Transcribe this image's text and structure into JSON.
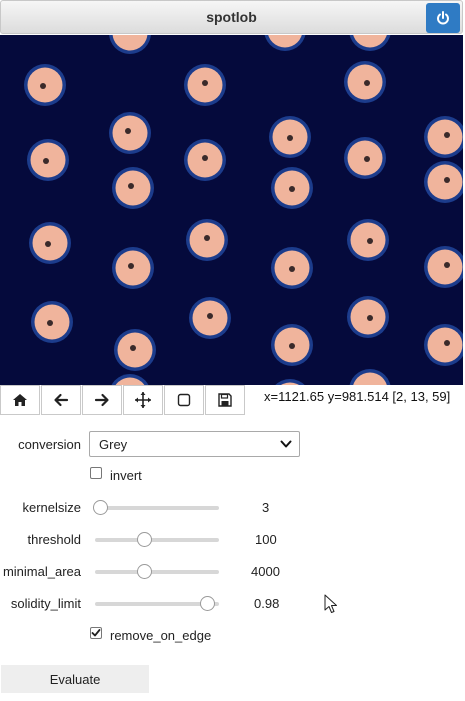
{
  "window": {
    "title": "spotlob"
  },
  "icons": {
    "close": "power-icon",
    "home": "home-icon",
    "back": "arrow-left-icon",
    "forward": "arrow-right-icon",
    "pan": "move-icon",
    "zoom": "zoom-rect-icon",
    "save": "floppy-disk-icon",
    "cursor": "mouse-pointer-icon"
  },
  "colors": {
    "accent": "#2f7bc4",
    "background": "#050a3c",
    "spot_fill": "#f0b49c",
    "spot_ring": "#1c3c8c"
  },
  "status": {
    "coords": "x=1121.65 y=981.514 [2, 13, 59]"
  },
  "controls": {
    "conversion": {
      "label": "conversion",
      "value": "Grey"
    },
    "invert": {
      "label": "invert",
      "checked": false
    },
    "kernelsize": {
      "label": "kernelsize",
      "value": "3",
      "level": 0.0
    },
    "threshold": {
      "label": "threshold",
      "value": "100",
      "level": 0.4
    },
    "minimal_area": {
      "label": "minimal_area",
      "value": "4000",
      "level": 0.4
    },
    "solidity_limit": {
      "label": "solidity_limit",
      "value": "0.98",
      "level": 0.98
    },
    "remove_on_edge": {
      "label": "remove_on_edge",
      "checked": true
    }
  },
  "actions": {
    "evaluate": "Evaluate"
  }
}
